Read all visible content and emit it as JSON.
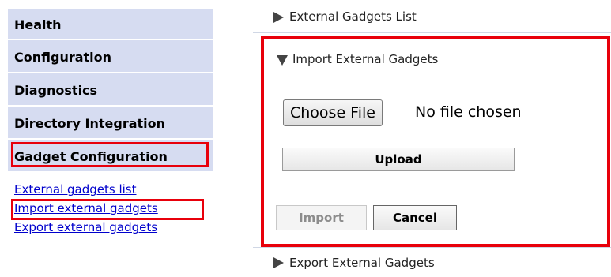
{
  "sidebar": {
    "headers": [
      {
        "label": "Health"
      },
      {
        "label": "Configuration"
      },
      {
        "label": "Diagnostics"
      },
      {
        "label": "Directory Integration"
      },
      {
        "label": "Gadget Configuration"
      }
    ],
    "links": [
      {
        "label": "External gadgets list"
      },
      {
        "label": "Import external gadgets"
      },
      {
        "label": "Export external gadgets"
      }
    ]
  },
  "main": {
    "sections": {
      "list": {
        "label": "External Gadgets List",
        "icon": "triangle-right-icon"
      },
      "import": {
        "label": "Import External Gadgets",
        "icon": "triangle-down-icon"
      },
      "export": {
        "label": "Export External Gadgets",
        "icon": "triangle-right-icon"
      }
    },
    "file_input": {
      "button_label": "Choose File",
      "status": "No file chosen"
    },
    "buttons": {
      "upload": "Upload",
      "import": "Import",
      "cancel": "Cancel"
    }
  },
  "colors": {
    "nav_background": "#d6dcf1",
    "highlight_border": "#e8000b",
    "link": "#0000cc"
  }
}
